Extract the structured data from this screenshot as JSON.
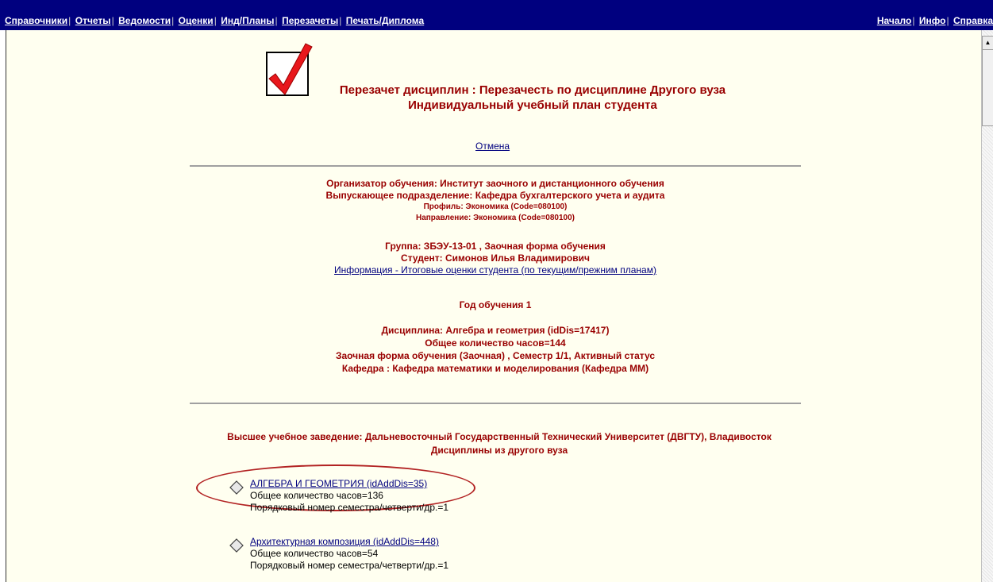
{
  "top_menu": {
    "left_items": [
      "Справочники",
      "Отчеты",
      "Ведомости",
      "Оценки",
      "Инд/Планы",
      "Перезачеты",
      "Печать/Диплома"
    ],
    "right_items": [
      "Начало",
      "Инфо",
      "Справка"
    ],
    "separator": "|"
  },
  "header": {
    "title_line1": "Перезачет дисциплин : Перезачесть по дисциплине Другого вуза",
    "title_line2": "Индивидуальный учебный план студента",
    "cancel_link": "Отмена"
  },
  "organizer": {
    "line1": "Организатор обучения: Институт заочного и дистанционного обучения",
    "line2": "Выпускающее подразделение: Кафедра бухгалтерского учета и аудита",
    "profile": "Профиль: Экономика (Code=080100)",
    "direction": "Направление: Экономика (Code=080100)"
  },
  "student": {
    "group": "Группа: ЗБЭУ-13-01 , Заочная форма обучения",
    "name": "Студент: Симонов Илья Владимирович",
    "info_link": "Информация - Итоговые оценки студента (по текущим/прежним планам)"
  },
  "year": "Год обучения 1",
  "discipline": {
    "name": "Дисциплина: Алгебра и геометрия (idDis=17417)",
    "hours": "Общее количество часов=144",
    "form": "Заочная форма обучения (Заочная) , Семестр 1/1, Активный статус",
    "department": "Кафедра : Кафедра математики и моделирования (Кафедра ММ)"
  },
  "university": {
    "line1": "Высшее учебное заведение: Дальневосточный Государственный Технический Университет (ДВГТУ), Владивосток",
    "line2": "Дисциплины из другого вуза"
  },
  "other_disciplines": [
    {
      "link": "АЛГЕБРА И ГЕОМЕТРИЯ (idAddDis=35)",
      "hours": "Общее количество часов=136",
      "order": "Порядковый номер семестра/четверти/др.=1"
    },
    {
      "link": "Архитектурная композиция (idAddDis=448)",
      "hours": "Общее количество часов=54",
      "order": "Порядковый номер семестра/четверти/др.=1"
    }
  ],
  "colors": {
    "topbar": "#00007f",
    "heading_text": "#990000",
    "page_bg": "#fffff0",
    "highlight_ellipse": "#b22222"
  }
}
